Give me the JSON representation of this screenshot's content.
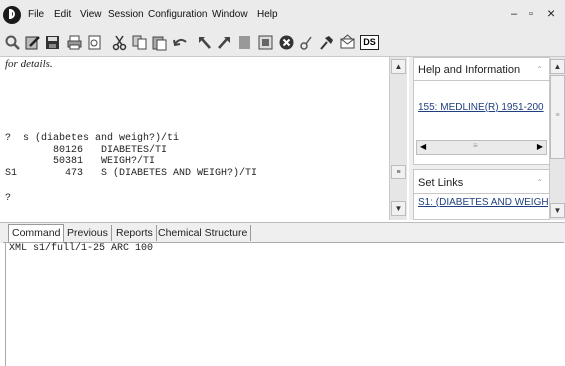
{
  "menu": {
    "items": [
      "File",
      "Edit",
      "View",
      "Session",
      "Configuration",
      "Window",
      "Help"
    ],
    "window_controls": {
      "minimize": "–",
      "maximize": "▫",
      "close": "×"
    }
  },
  "toolbar": {
    "icons": [
      "search-icon",
      "edit-icon",
      "save-icon",
      "print-icon",
      "preview-icon",
      "cut-icon",
      "copy-icon",
      "paste-icon",
      "undo-icon",
      "back-icon",
      "redo-icon",
      "pause-icon",
      "window-icon",
      "stop-icon",
      "key-icon",
      "pin-icon",
      "mail-icon",
      "ds-icon"
    ],
    "ds_label": "DS"
  },
  "output": {
    "details_text": "for details.",
    "lines": [
      "?  s (diabetes and weigh?)/ti",
      "        80126   DIABETES/TI",
      "        50381   WEIGH?/TI",
      "S1        473   S (DIABETES AND WEIGH?)/TI",
      "",
      "?"
    ]
  },
  "side": {
    "help_title": "Help and Information",
    "help_link": "155: MEDLINE(R) 1951-200",
    "set_title": "Set Links",
    "set_link": "S1: (DIABETES AND WEIGH"
  },
  "tabs": [
    "Command",
    "Previous",
    "Reports",
    "Chemical Structure"
  ],
  "command": {
    "text": "XML s1/full/1-25 ARC 100"
  }
}
